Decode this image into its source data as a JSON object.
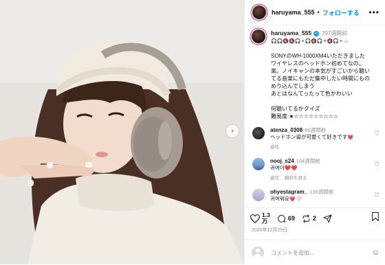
{
  "header": {
    "username": "haruyama_555",
    "follow_label": "フォローする",
    "more": "•••"
  },
  "caption": {
    "username": "haruyama_555",
    "time": "297週間前",
    "emoji_row": "🎧🎧🔇🔇🎧⚫🎧🔇🎧⚫🔇🎧⚫☁️",
    "text": "SONYのWH-1000XM4いただきました\nワイヤレスのヘッドホン初めてなの。\n楽。ノイキャンの本気がすごいから聴い\nてる音楽にもただ集中したい時間にもの\nめり込んでしまう\nあとはなんてったって色かわいい",
    "text2": "何聴いてるかクイズ\n難易度:★☆☆☆☆☆☆☆☆☆"
  },
  "comments": [
    {
      "username": "atenza_0308",
      "time": "66週間前",
      "text": "ヘッドホン姿が可愛くて好きです💗",
      "reply": "返信",
      "see_translation": ""
    },
    {
      "username": "nooj_s24",
      "time": "104週間前",
      "text": "귀여이❤️❤️",
      "reply": "返信",
      "see_translation": "翻訳を見る"
    },
    {
      "username": "ohyestagram_",
      "time": "136週間前",
      "text": "귀여워요💗🤍",
      "reply": "",
      "see_translation": ""
    }
  ],
  "actions": {
    "likes_line1": "1.3",
    "likes_line2": "万",
    "comments": "69",
    "reposts": "2"
  },
  "date": "2020年12月29日",
  "add_comment": {
    "placeholder": "コメントを追加...",
    "emoji_icon": "smiley-icon"
  },
  "colors": {
    "accent": "#0095f6",
    "verified": "#1d9bf0",
    "muted": "#8e8e8e",
    "border": "#efefef"
  }
}
